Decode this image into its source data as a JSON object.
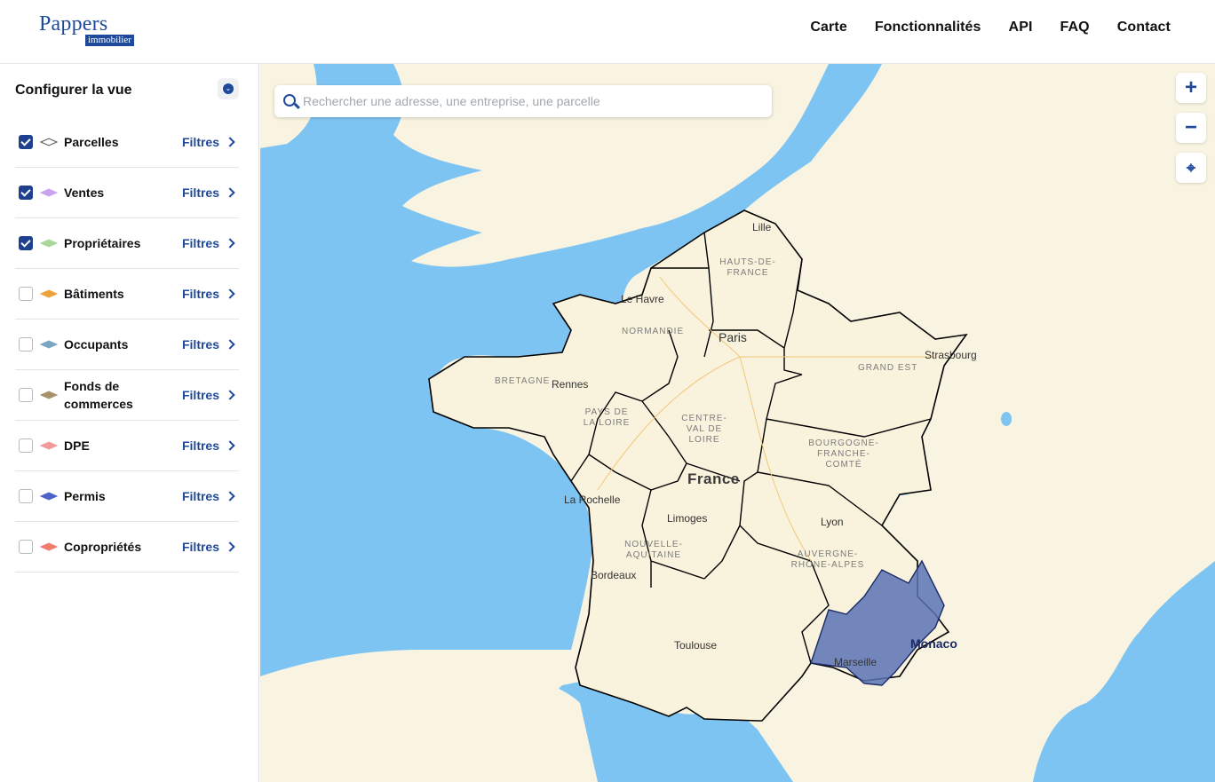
{
  "header": {
    "logo_main": "Pappers",
    "logo_sub": "immobilier",
    "nav": [
      "Carte",
      "Fonctionnalités",
      "API",
      "FAQ",
      "Contact"
    ]
  },
  "sidebar": {
    "title": "Configurer la vue",
    "filters_label": "Filtres",
    "layers": [
      {
        "label": "Parcelles",
        "checked": true,
        "color": "#ffffff"
      },
      {
        "label": "Ventes",
        "checked": true,
        "color": "#c9a3f0"
      },
      {
        "label": "Propriétaires",
        "checked": true,
        "color": "#a9d89a"
      },
      {
        "label": "Bâtiments",
        "checked": false,
        "color": "#f0a23a"
      },
      {
        "label": "Occupants",
        "checked": false,
        "color": "#7aa6c2"
      },
      {
        "label": "Fonds de commerces",
        "checked": false,
        "color": "#a8926a"
      },
      {
        "label": "DPE",
        "checked": false,
        "color": "#f29a9a"
      },
      {
        "label": "Permis",
        "checked": false,
        "color": "#4a62c9"
      },
      {
        "label": "Copropriétés",
        "checked": false,
        "color": "#ef7b6b"
      }
    ]
  },
  "map": {
    "search_placeholder": "Rechercher une adresse, une entreprise, une parcelle",
    "controls": [
      "plus-icon",
      "minus-icon",
      "locate-icon"
    ],
    "country": "France",
    "cities": [
      "Lille",
      "Le Havre",
      "Paris",
      "Strasbourg",
      "Rennes",
      "Limoges",
      "Lyon",
      "La Rochelle",
      "Bordeaux",
      "Toulouse",
      "Marseille",
      "Monaco"
    ],
    "regions": [
      "HAUTS-DE-FRANCE",
      "NORMANDIE",
      "GRAND EST",
      "BRETAGNE",
      "PAYS DE LA LOIRE",
      "CENTRE-VAL DE LOIRE",
      "BOURGOGNE-FRANCHE-COMTÉ",
      "NOUVELLE-AQUITAINE",
      "AUVERGNE-RHÔNE-ALPES"
    ],
    "colors": {
      "sea": "#7ec4f2",
      "land": "#f8f4e1",
      "highlight": "#5b73b5",
      "brand": "#1f4a9b"
    }
  }
}
